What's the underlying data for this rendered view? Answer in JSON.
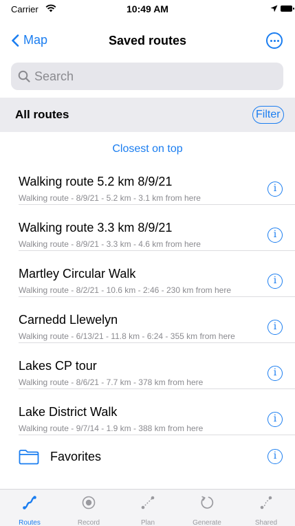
{
  "status_bar": {
    "carrier": "Carrier",
    "time": "10:49 AM"
  },
  "nav": {
    "back_label": "Map",
    "title": "Saved routes"
  },
  "search": {
    "placeholder": "Search",
    "value": ""
  },
  "section": {
    "title": "All routes",
    "filter_label": "Filter"
  },
  "sort_label": "Closest on top",
  "routes": [
    {
      "title": "Walking route 5.2 km 8/9/21",
      "subtitle": "Walking route - 8/9/21 - 5.2 km - 3.1 km from here"
    },
    {
      "title": "Walking route 3.3 km 8/9/21",
      "subtitle": "Walking route - 8/9/21 - 3.3 km - 4.6 km from here"
    },
    {
      "title": "Martley Circular Walk",
      "subtitle": "Walking route - 8/2/21 - 10.6 km - 2:46 - 230 km from here"
    },
    {
      "title": "Carnedd Llewelyn",
      "subtitle": "Walking route - 6/13/21 - 11.8 km - 6:24 - 355 km from here"
    },
    {
      "title": "Lakes CP tour",
      "subtitle": "Walking route - 8/6/21 - 7.7 km - 378 km from here"
    },
    {
      "title": "Lake District Walk",
      "subtitle": "Walking route - 9/7/14 - 1.9 km - 388 km from here"
    }
  ],
  "folder": {
    "label": "Favorites",
    "icon": "folder-icon"
  },
  "tabs": [
    {
      "label": "Routes",
      "icon": "route-icon"
    },
    {
      "label": "Record",
      "icon": "record-icon"
    },
    {
      "label": "Plan",
      "icon": "plan-icon"
    },
    {
      "label": "Generate",
      "icon": "generate-icon"
    },
    {
      "label": "Shared",
      "icon": "shared-icon"
    }
  ],
  "colors": {
    "accent": "#1a7df0",
    "secondary_text": "#8a8a8f",
    "section_bg": "#ebebef"
  }
}
